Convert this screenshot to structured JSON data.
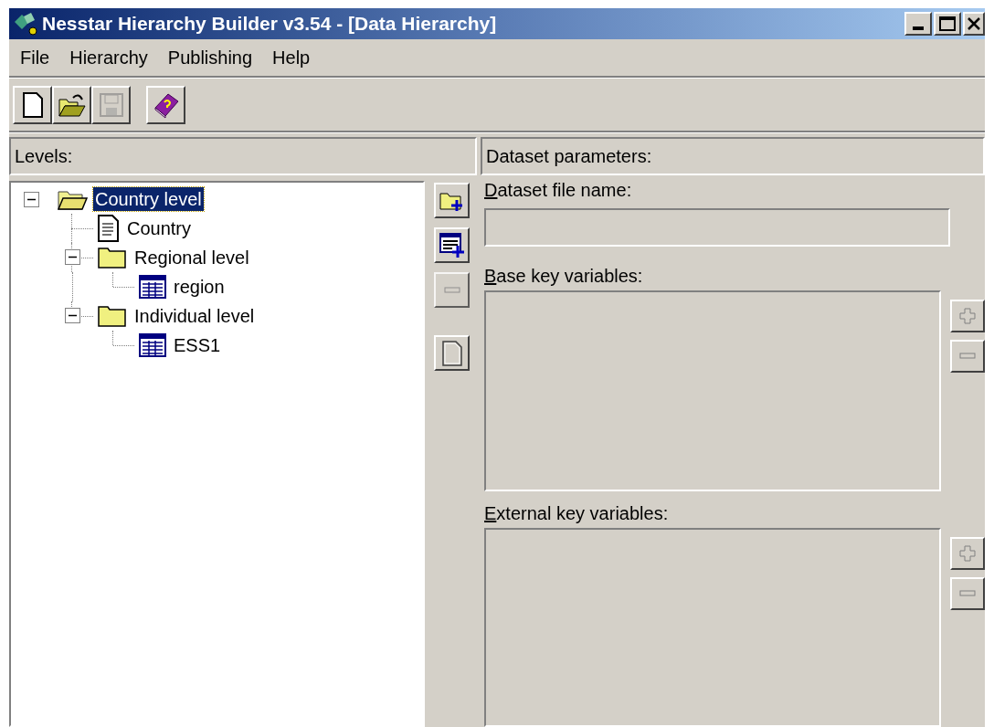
{
  "window": {
    "title": "Nesstar Hierarchy Builder v3.54 - [Data Hierarchy]"
  },
  "menu": [
    "File",
    "Hierarchy",
    "Publishing",
    "Help"
  ],
  "toolbar": [
    {
      "kind": "new",
      "disabled": false
    },
    {
      "kind": "open",
      "disabled": false
    },
    {
      "kind": "save",
      "disabled": true
    },
    {
      "kind": "help",
      "disabled": false
    }
  ],
  "levels_panel": {
    "title": "Levels:",
    "tree": [
      {
        "label": "Country level",
        "kind": "folder_open",
        "selected": true,
        "expanded": true,
        "children": [
          {
            "label": "Country",
            "kind": "document",
            "selected": false
          },
          {
            "label": "Regional level",
            "kind": "folder",
            "selected": false,
            "expanded": true,
            "children": [
              {
                "label": "region",
                "kind": "table",
                "selected": false
              }
            ]
          },
          {
            "label": "Individual level",
            "kind": "folder",
            "selected": false,
            "expanded": true,
            "children": [
              {
                "label": "ESS1",
                "kind": "table",
                "selected": false
              }
            ]
          }
        ]
      }
    ]
  },
  "level_buttons": [
    {
      "kind": "add_level",
      "disabled": false
    },
    {
      "kind": "add_dataset",
      "disabled": false
    },
    {
      "kind": "remove",
      "disabled": true
    },
    {
      "kind": "page",
      "disabled": false
    }
  ],
  "dataset_panel": {
    "title": "Dataset parameters:",
    "fields": [
      {
        "kind": "text",
        "label": "Dataset file name:",
        "underline_first": true,
        "disabled": true
      },
      {
        "kind": "list",
        "label": "Base key variables:",
        "underline_first": true,
        "buttons": [
          {
            "kind": "add",
            "disabled": true
          },
          {
            "kind": "remove",
            "disabled": true
          }
        ]
      },
      {
        "kind": "list",
        "label": "External key variables:",
        "underline_first": true,
        "buttons": [
          {
            "kind": "add",
            "disabled": true
          },
          {
            "kind": "remove",
            "disabled": true
          }
        ]
      }
    ]
  }
}
